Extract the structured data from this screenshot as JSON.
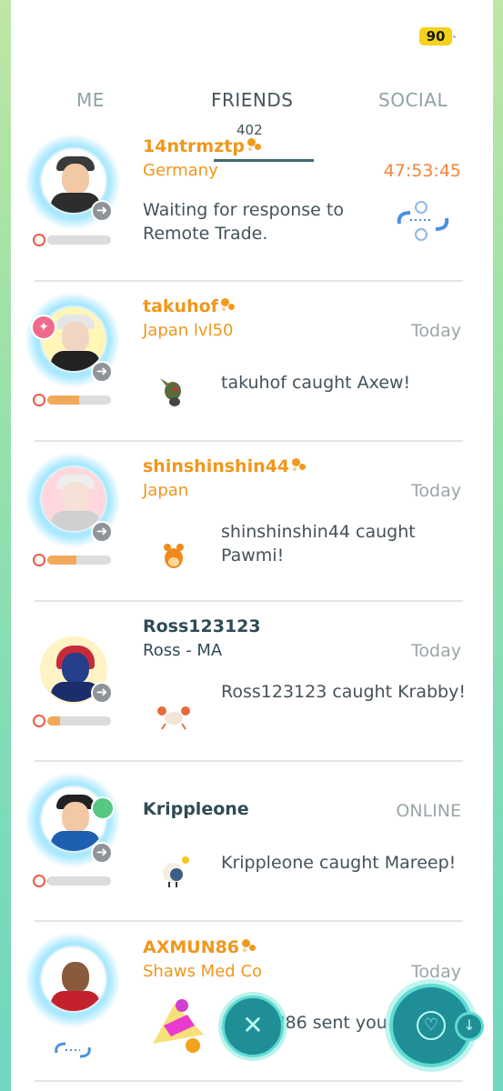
{
  "header": {
    "badge_value": "90"
  },
  "tabs": [
    {
      "label": "ME"
    },
    {
      "label": "FRIENDS",
      "active": true
    },
    {
      "label": "SOCIAL"
    }
  ],
  "friend_count": "402",
  "colors": {
    "accent_orange": "#f0971c",
    "teal": "#1f8e96",
    "timer": "#f2843e"
  },
  "friends": [
    {
      "name": "14ntrmztp",
      "subtitle": "Germany",
      "status": "47:53:45",
      "message": "Waiting for response to Remote Trade.",
      "friendship": 0.0,
      "icon": "trade-icon"
    },
    {
      "name": "takuhof",
      "subtitle": "Japan lvl50",
      "status": "Today",
      "message": "takuhof caught Axew!",
      "friendship": 0.5,
      "pokemon_icon": "axew-icon"
    },
    {
      "name": "shinshinshin44",
      "subtitle": "Japan",
      "status": "Today",
      "message": "shinshinshin44 caught Pawmi!",
      "friendship": 0.45,
      "pokemon_icon": "pawmi-icon"
    },
    {
      "name": "Ross123123",
      "subtitle": "Ross - MA",
      "status": "Today",
      "message": "Ross123123 caught Krabby!",
      "friendship": 0.2,
      "pokemon_icon": "krabby-icon"
    },
    {
      "name": "Krippleone",
      "subtitle": "",
      "status": "ONLINE",
      "message": "Krippleone caught Mareep!",
      "friendship": 0.02,
      "pokemon_icon": "mareep-icon"
    },
    {
      "name": "AXMUN86",
      "subtitle": "Shaws Med Co",
      "status": "Today",
      "message": "AXMUN86 sent you",
      "friendship": 0.0,
      "pokemon_icon": "gift-icon"
    }
  ],
  "fab": {
    "close_icon": "close-icon",
    "heart_icon": "heart-icon",
    "download_icon": "download-icon"
  }
}
